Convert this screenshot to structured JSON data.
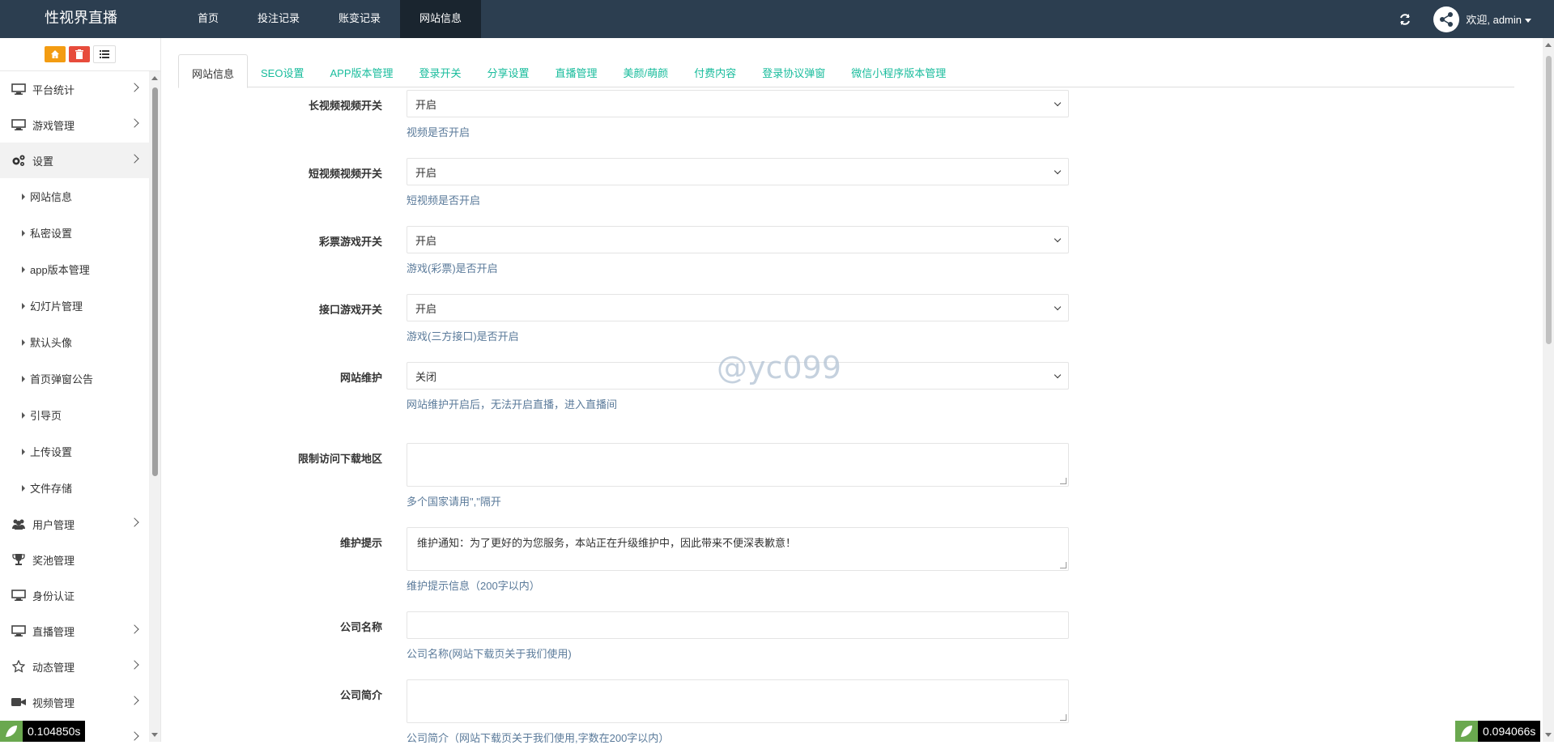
{
  "brand": "性视界直播",
  "topnav": [
    "首页",
    "投注记录",
    "账变记录",
    "网站信息"
  ],
  "topnav_active": 3,
  "user": {
    "welcome": "欢迎, admin"
  },
  "sidebar": {
    "items": [
      {
        "label": "平台统计",
        "icon": "monitor-icon",
        "chevron": true
      },
      {
        "label": "游戏管理",
        "icon": "monitor-icon",
        "chevron": true
      },
      {
        "label": "设置",
        "icon": "gears-icon",
        "chevron": true,
        "active": true
      },
      {
        "label": "网站信息",
        "sub": true
      },
      {
        "label": "私密设置",
        "sub": true
      },
      {
        "label": "app版本管理",
        "sub": true
      },
      {
        "label": "幻灯片管理",
        "sub": true
      },
      {
        "label": "默认头像",
        "sub": true
      },
      {
        "label": "首页弹窗公告",
        "sub": true
      },
      {
        "label": "引导页",
        "sub": true
      },
      {
        "label": "上传设置",
        "sub": true
      },
      {
        "label": "文件存储",
        "sub": true
      },
      {
        "label": "用户管理",
        "icon": "users-icon",
        "chevron": true
      },
      {
        "label": "奖池管理",
        "icon": "trophy-icon",
        "chevron": false
      },
      {
        "label": "身份认证",
        "icon": "monitor-icon",
        "chevron": false
      },
      {
        "label": "直播管理",
        "icon": "monitor-icon",
        "chevron": true
      },
      {
        "label": "动态管理",
        "icon": "star-icon",
        "chevron": true
      },
      {
        "label": "视频管理",
        "icon": "video-icon",
        "chevron": true
      },
      {
        "label": "",
        "icon": "",
        "chevron": true
      }
    ]
  },
  "tabs": [
    "网站信息",
    "SEO设置",
    "APP版本管理",
    "登录开关",
    "分享设置",
    "直播管理",
    "美颜/萌颜",
    "付费内容",
    "登录协议弹窗",
    "微信小程序版本管理"
  ],
  "tab_active": 0,
  "form": [
    {
      "label": "长视频视频开关",
      "type": "select",
      "value": "开启",
      "help": "视频是否开启"
    },
    {
      "label": "短视频视频开关",
      "type": "select",
      "value": "开启",
      "help": "短视频是否开启"
    },
    {
      "label": "彩票游戏开关",
      "type": "select",
      "value": "开启",
      "help": "游戏(彩票)是否开启"
    },
    {
      "label": "接口游戏开关",
      "type": "select",
      "value": "开启",
      "help": "游戏(三方接口)是否开启"
    },
    {
      "label": "网站维护",
      "type": "select",
      "value": "关闭",
      "help": "网站维护开启后，无法开启直播，进入直播间"
    },
    {
      "label": "限制访问下载地区",
      "type": "textarea",
      "value": "",
      "help": "多个国家请用\",\"隔开"
    },
    {
      "label": "维护提示",
      "type": "textarea",
      "value": "维护通知：为了更好的为您服务，本站正在升级维护中，因此带来不便深表歉意！",
      "help": "维护提示信息（200字以内）"
    },
    {
      "label": "公司名称",
      "type": "input",
      "value": "",
      "help": "公司名称(网站下载页关于我们使用)"
    },
    {
      "label": "公司简介",
      "type": "textarea",
      "value": "",
      "help": "公司简介（网站下载页关于我们使用,字数在200字以内）"
    }
  ],
  "watermark": "@yc099",
  "timer_left": "0.104850s",
  "timer_right": "0.094066s",
  "colors": {
    "topbar": "#2c3e50",
    "tab_link": "#18bc9c",
    "help_text": "#5a7a9a"
  }
}
